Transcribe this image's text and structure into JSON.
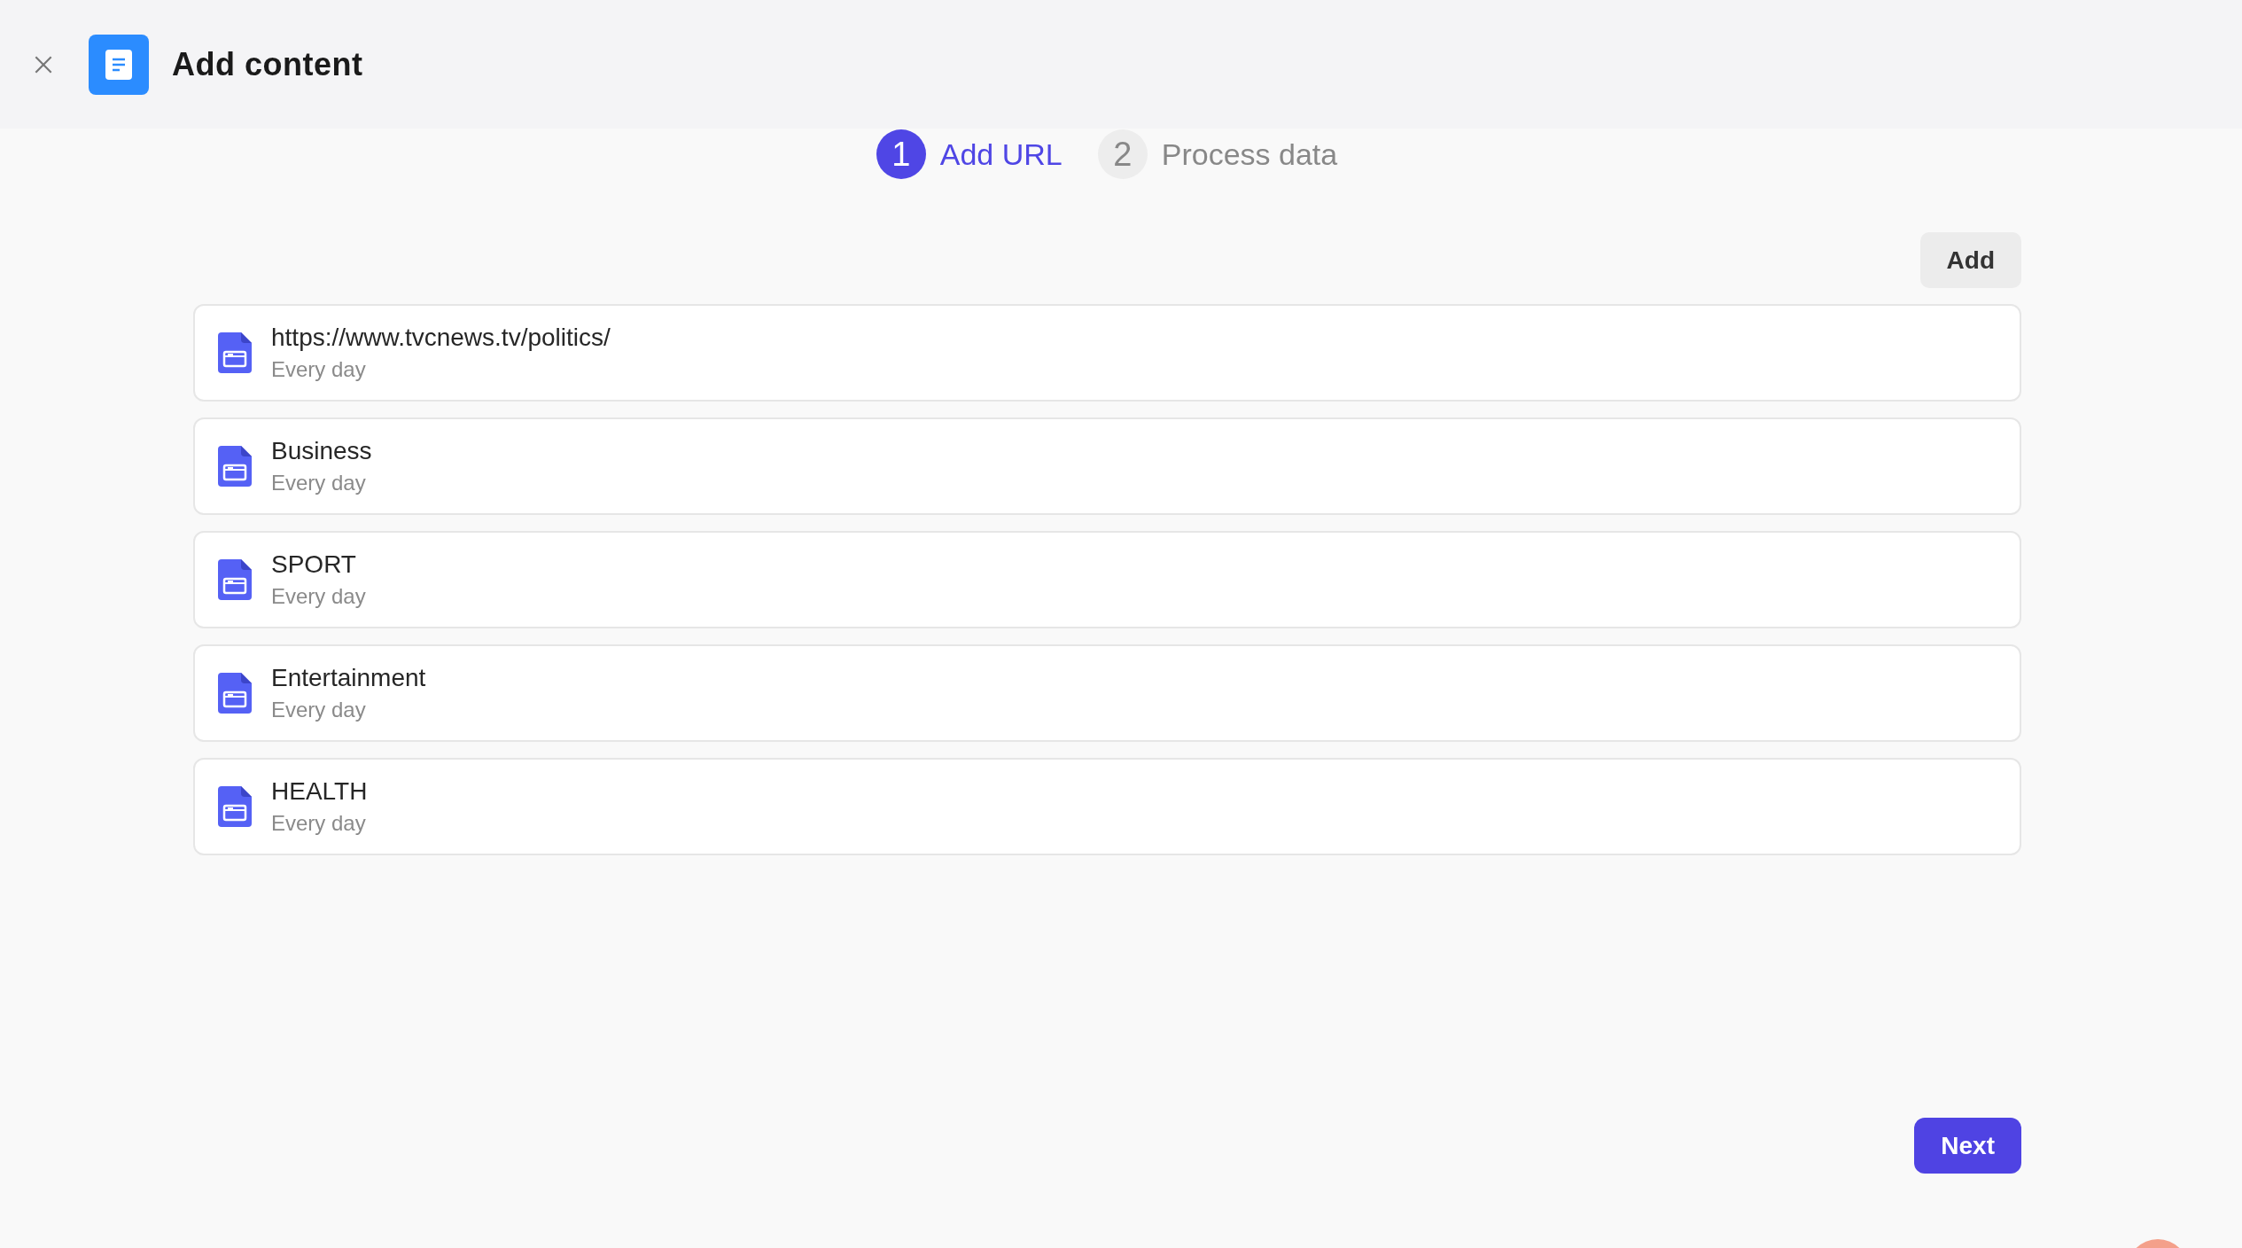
{
  "header": {
    "title": "Add content"
  },
  "steps": [
    {
      "number": "1",
      "label": "Add URL",
      "selected": true
    },
    {
      "number": "2",
      "label": "Process data",
      "selected": false
    }
  ],
  "add_button": "Add",
  "sources": [
    {
      "title": "https://www.tvcnews.tv/politics/",
      "frequency": "Every day"
    },
    {
      "title": "Business",
      "frequency": "Every day"
    },
    {
      "title": "SPORT",
      "frequency": "Every day"
    },
    {
      "title": "Entertainment",
      "frequency": "Every day"
    },
    {
      "title": "HEALTH",
      "frequency": "Every day"
    }
  ],
  "next_button": "Next"
}
